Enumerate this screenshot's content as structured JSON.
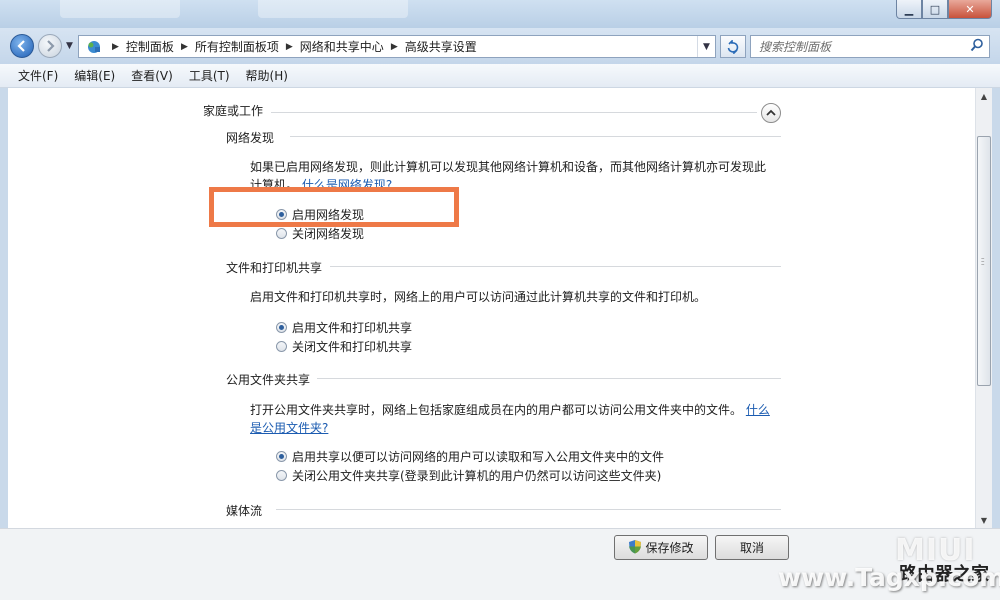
{
  "window": {
    "controls": {
      "minimize": "▁",
      "maximize": "□",
      "close": "✕"
    }
  },
  "address_bar": {
    "breadcrumbs": [
      "控制面板",
      "所有控制面板项",
      "网络和共享中心",
      "高级共享设置"
    ]
  },
  "search": {
    "placeholder": "搜索控制面板"
  },
  "menu": [
    "文件(F)",
    "编辑(E)",
    "查看(V)",
    "工具(T)",
    "帮助(H)"
  ],
  "profile": {
    "title": "家庭或工作"
  },
  "sections": {
    "discovery": {
      "title": "网络发现",
      "desc_line1": "如果已启用网络发现，则此计算机可以发现其他网络计算机和设备，而其他网络计算机亦可发现此",
      "desc_line2": "计算机。",
      "link": "什么是网络发现?",
      "options": [
        {
          "label": "启用网络发现",
          "selected": true
        },
        {
          "label": "关闭网络发现",
          "selected": false
        }
      ]
    },
    "printer_sharing": {
      "title": "文件和打印机共享",
      "desc": "启用文件和打印机共享时，网络上的用户可以访问通过此计算机共享的文件和打印机。",
      "options": [
        {
          "label": "启用文件和打印机共享",
          "selected": true
        },
        {
          "label": "关闭文件和打印机共享",
          "selected": false
        }
      ]
    },
    "public_folder": {
      "title": "公用文件夹共享",
      "desc_line1": "打开公用文件夹共享时，网络上包括家庭组成员在内的用户都可以访问公用文件夹中的文件。",
      "link_part1": "什么",
      "link_part2": "是公用文件夹?",
      "options": [
        {
          "label": "启用共享以便可以访问网络的用户可以读取和写入公用文件夹中的文件",
          "selected": true
        },
        {
          "label": "关闭公用文件夹共享(登录到此计算机的用户仍然可以访问这些文件夹)",
          "selected": false
        }
      ]
    },
    "media": {
      "title": "媒体流"
    }
  },
  "footer": {
    "save_label": "保存修改",
    "cancel_label": "取消"
  },
  "watermark": {
    "logo": "MIUI",
    "url": "www.Tagxp.com",
    "cn": "路由器之家"
  },
  "colors": {
    "highlight": "#ee7947",
    "link": "#1c5cb1"
  }
}
